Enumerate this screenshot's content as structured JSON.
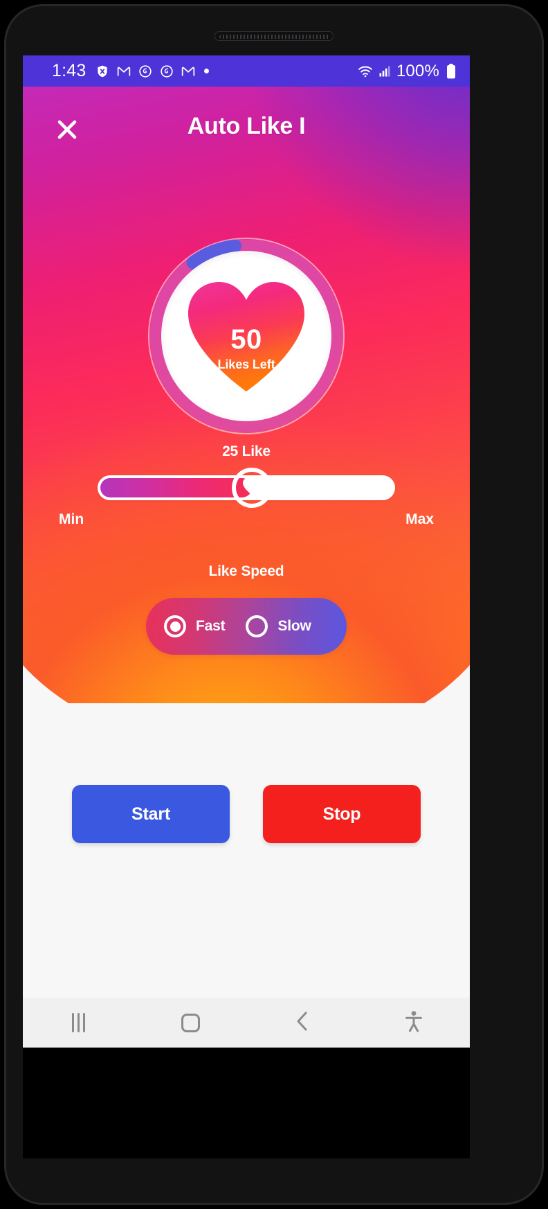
{
  "status_bar": {
    "time": "1:43",
    "battery_text": "100%",
    "icons": [
      "shield-icon",
      "gmail-icon",
      "clock-icon",
      "clock-icon",
      "gmail-icon",
      "dot-icon"
    ],
    "right_icons": [
      "wifi-icon",
      "cellular-signal-icon",
      "battery-icon"
    ],
    "background_color": "#4d33d8"
  },
  "app_bar": {
    "title": "Auto Like I",
    "close_label": "×"
  },
  "likes_ring": {
    "count": "50",
    "label": "Likes Left",
    "progress_percent": 8,
    "ring_track_color": "#d94fb0",
    "ring_progress_color": "#5a5ce0"
  },
  "slider": {
    "value_label": "25 Like",
    "min_label": "Min",
    "max_label": "Max",
    "value_percent": 52,
    "fill_from": "#b635bb",
    "fill_to": "#f72d55"
  },
  "speed": {
    "title": "Like Speed",
    "options": [
      {
        "label": "Fast",
        "selected": true
      },
      {
        "label": "Slow",
        "selected": false
      }
    ]
  },
  "actions": {
    "start_label": "Start",
    "stop_label": "Stop",
    "start_color": "#3b59e0",
    "stop_color": "#f4201d"
  },
  "nav_bar": {
    "items": [
      "recents-icon",
      "home-icon",
      "back-icon",
      "accessibility-icon"
    ]
  }
}
